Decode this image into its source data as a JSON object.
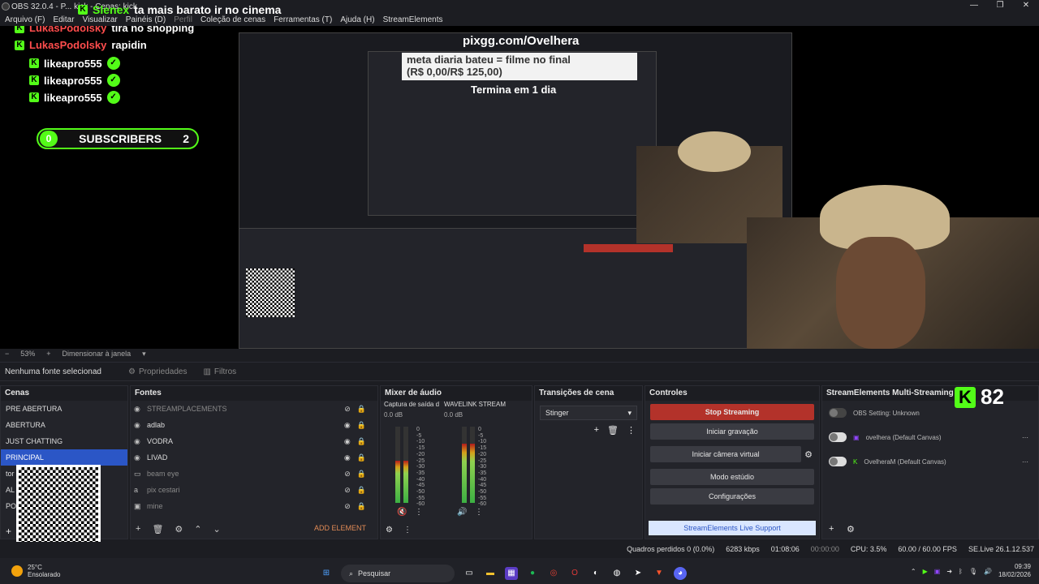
{
  "window": {
    "title": "OBS 32.0.4 - P... kick - Cenas: kick"
  },
  "menu": [
    "Arquivo (F)",
    "Editar",
    "Visualizar",
    "Painéis (D)",
    "Perfil",
    "Coleção de cenas",
    "Ferramentas (T)",
    "Ajuda (H)",
    "StreamElements"
  ],
  "preview": {
    "top_chat": {
      "user": "Slenex",
      "text": "ta mais barato ir no cinema"
    },
    "chat": [
      {
        "user": "LukasPodolsky",
        "text": "tira no shopping"
      },
      {
        "user": "LukasPodolsky",
        "text": "rapidin"
      },
      {
        "user": "likeapro555",
        "text": ""
      },
      {
        "user": "likeapro555",
        "text": ""
      },
      {
        "user": "likeapro555",
        "text": ""
      }
    ],
    "subs": {
      "left": "0",
      "label": "SUBSCRIBERS",
      "right": "2"
    },
    "pix": "pixgg.com/Ovelhera",
    "meta_line1": "meta diaria bateu = filme no final",
    "meta_line2": "(R$ 0,00/R$ 125,00)",
    "termina": "Termina em 1 dia",
    "kick_count": "82"
  },
  "zoom": {
    "percent": "53%",
    "fit": "Dimensionar à janela"
  },
  "propbar": {
    "none": "Nenhuma fonte selecionad",
    "props": "Propriedades",
    "filters": "Filtros"
  },
  "scenes": {
    "title": "Cenas",
    "items": [
      "PRE ABERTURA",
      "ABERTURA",
      "JUST CHATTING",
      "PRINCIPAL",
      "tor",
      "AL",
      "PO"
    ]
  },
  "sources": {
    "title": "Fontes",
    "items": [
      {
        "name": "STREAMPLACEMENTS",
        "visible": false
      },
      {
        "name": "adlab",
        "visible": true
      },
      {
        "name": "VODRA",
        "visible": true
      },
      {
        "name": "LIVAD",
        "visible": true
      },
      {
        "name": "beam eye",
        "visible": false
      },
      {
        "name": "pix cestari",
        "visible": false
      },
      {
        "name": "mine",
        "visible": false
      }
    ],
    "add": "ADD ELEMENT"
  },
  "mixer": {
    "title": "Mixer de áudio",
    "channels": [
      {
        "name": "Captura de saída d",
        "db": "0.0 dB",
        "level": 0.55
      },
      {
        "name": "WAVELINK STREAM",
        "db": "0.0 dB",
        "level": 0.78
      }
    ],
    "ticks": [
      "0",
      "-5",
      "-10",
      "-15",
      "-20",
      "-25",
      "-30",
      "-35",
      "-40",
      "-45",
      "-50",
      "-55",
      "-60"
    ]
  },
  "transitions": {
    "title": "Transições de cena",
    "selected": "Stinger"
  },
  "controls": {
    "title": "Controles",
    "stop": "Stop Streaming",
    "rec": "Iniciar gravação",
    "vcam": "Iniciar câmera virtual",
    "studio": "Modo estúdio",
    "settings": "Configurações",
    "support": "StreamElements Live Support"
  },
  "se": {
    "title": "StreamElements Multi-Streaming",
    "rows": [
      {
        "label": "OBS Setting: Unknown"
      },
      {
        "label": "ovelhera (Default Canvas)"
      },
      {
        "label": "OvelheraM (Default Canvas)"
      }
    ]
  },
  "status": {
    "dropped": "Quadros perdidos 0 (0.0%)",
    "kbps": "6283 kbps",
    "live": "01:08:06",
    "rec": "00:00:00",
    "cpu": "CPU: 3.5%",
    "fps": "60.00 / 60.00 FPS",
    "ver": "SE.Live 26.1.12.537"
  },
  "taskbar": {
    "temp": "25°C",
    "weather": "Ensolarado",
    "search": "Pesquisar",
    "time": "09:39",
    "date": "18/02/2026"
  },
  "colors": {
    "accent": "#2b56c6",
    "kick": "#53fc18",
    "stop": "#b3322a"
  }
}
